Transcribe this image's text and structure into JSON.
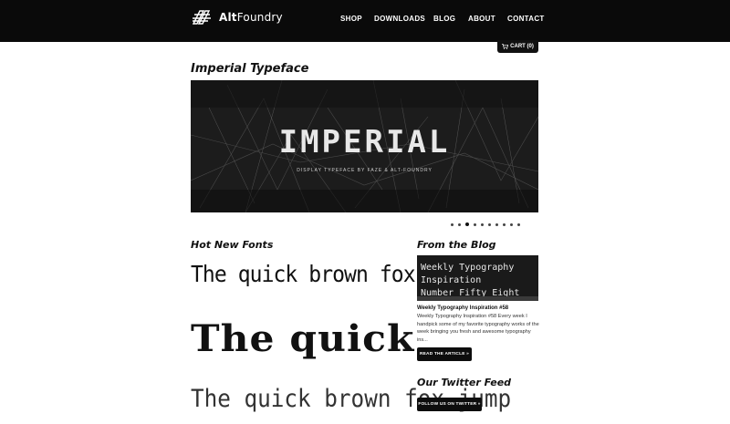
{
  "header": {
    "logo_alt": "Alt",
    "logo_foundry": "Foundry",
    "nav": [
      {
        "label": "SHOP"
      },
      {
        "label": "DOWNLOADS"
      },
      {
        "label": "BLOG"
      },
      {
        "label": "ABOUT"
      },
      {
        "label": "CONTACT"
      }
    ],
    "cart_label": "CART (0)"
  },
  "hero": {
    "heading": "Imperial Typeface",
    "banner_title": "IMPERIAL",
    "banner_subtitle": "DISPLAY TYPEFACE BY FAZE & ALT-FOUNDRY",
    "slides_total": 10,
    "active_slide": 3
  },
  "hot_fonts": {
    "heading": "Hot New Fonts",
    "samples": [
      {
        "text": "The quick brown fox jump"
      },
      {
        "text": "The quick"
      },
      {
        "text": "The quick brown fox jump"
      }
    ]
  },
  "blog": {
    "heading": "From the Blog",
    "image_line1": "Weekly Typography Inspiration",
    "image_line2": "Number Fifty Eight",
    "post_title": "Weekly Typography Inspiration #58",
    "post_excerpt": "Weekly Typography Inspiration #58 Every week I handpick some of my favorite typography works of the week bringing you fresh and awesome typography ins...",
    "read_button": "READ THE ARTICLE »"
  },
  "twitter": {
    "heading": "Our Twitter Feed",
    "follow_button": "FOLLOW US ON TWITTER »"
  }
}
